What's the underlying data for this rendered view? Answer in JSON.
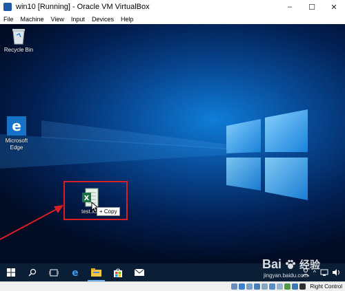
{
  "window": {
    "title": "win10 [Running] - Oracle VM VirtualBox",
    "minimize": "–",
    "maximize": "☐",
    "close": "✕"
  },
  "menu": [
    "File",
    "Machine",
    "View",
    "Input",
    "Devices",
    "Help"
  ],
  "desktop": {
    "icons": [
      {
        "label": "Recycle Bin",
        "icon": "recycle-bin-icon"
      },
      {
        "label": "Microsoft\nEdge",
        "icon": "edge-icon"
      }
    ],
    "dragged_file": {
      "label": "test.xlsx",
      "icon": "excel-file-icon"
    },
    "drag_tooltip": "+ Copy"
  },
  "taskbar": {
    "items": [
      "start-icon",
      "search-icon",
      "task-view-icon",
      "edge-icon",
      "file-explorer-icon",
      "store-icon",
      "mail-icon"
    ]
  },
  "statusbar": {
    "host_key": "Right Control"
  },
  "watermark": {
    "brand": "Bai",
    "brand_cn": "经验",
    "url": "jingyan.baidu.com"
  }
}
